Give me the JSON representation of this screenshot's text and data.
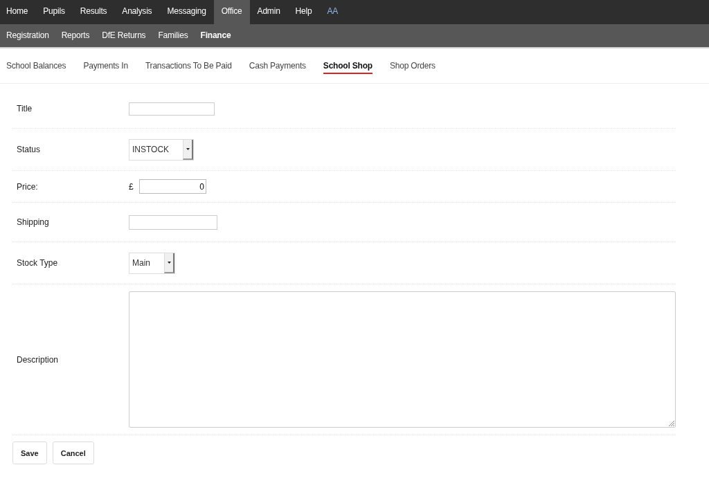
{
  "top_nav": [
    {
      "label": "Home",
      "selected": false
    },
    {
      "label": "Pupils",
      "selected": false
    },
    {
      "label": "Results",
      "selected": false
    },
    {
      "label": "Analysis",
      "selected": false
    },
    {
      "label": "Messaging",
      "selected": false
    },
    {
      "label": "Office",
      "selected": true
    },
    {
      "label": "Admin",
      "selected": false
    },
    {
      "label": "Help",
      "selected": false
    }
  ],
  "user": "AA",
  "sub_nav": [
    {
      "label": "Registration",
      "selected": false
    },
    {
      "label": "Reports",
      "selected": false
    },
    {
      "label": "DfE Returns",
      "selected": false
    },
    {
      "label": "Families",
      "selected": false
    },
    {
      "label": "Finance",
      "selected": true
    }
  ],
  "tabs": [
    {
      "label": "School Balances",
      "selected": false
    },
    {
      "label": "Payments In",
      "selected": false
    },
    {
      "label": "Transactions To Be Paid",
      "selected": false
    },
    {
      "label": "Cash Payments",
      "selected": false
    },
    {
      "label": "School Shop",
      "selected": true
    },
    {
      "label": "Shop Orders",
      "selected": false
    }
  ],
  "form": [
    {
      "kind": "text",
      "label": "Title"
    },
    {
      "kind": "select",
      "label": "Status",
      "value": "INSTOCK"
    },
    {
      "kind": "currency",
      "label": "Price:",
      "symbol": "£",
      "value": "0"
    },
    {
      "kind": "text",
      "label": "Shipping"
    },
    {
      "kind": "select",
      "label": "Stock Type",
      "value": "Main"
    },
    {
      "kind": "textarea",
      "label": "Description"
    }
  ],
  "buttons": [
    "Save",
    "Cancel"
  ]
}
